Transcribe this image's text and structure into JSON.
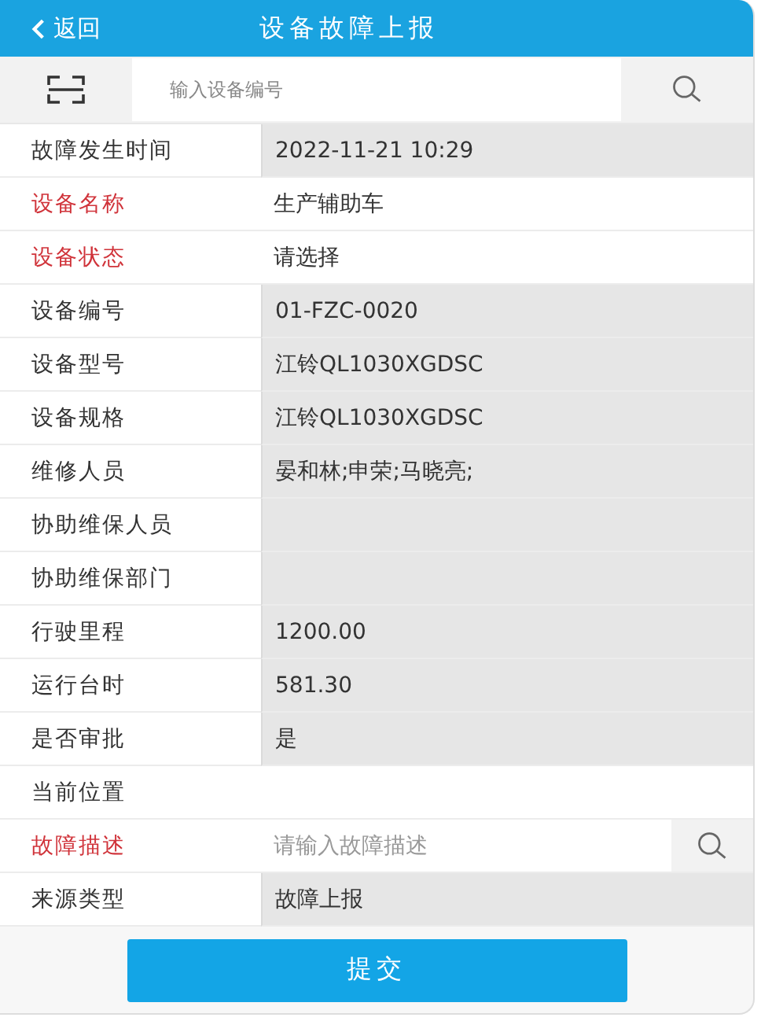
{
  "header": {
    "back": "返回",
    "title": "设备故障上报"
  },
  "search": {
    "placeholder": "输入设备编号"
  },
  "rows": [
    {
      "label": "故障发生时间",
      "required": false,
      "readonly": true,
      "value": "2022-11-21 10:29"
    },
    {
      "label": "设备名称",
      "required": true,
      "readonly": false,
      "value": "生产辅助车"
    },
    {
      "label": "设备状态",
      "required": true,
      "readonly": false,
      "value": "请选择"
    },
    {
      "label": "设备编号",
      "required": false,
      "readonly": true,
      "value": "01-FZC-0020"
    },
    {
      "label": "设备型号",
      "required": false,
      "readonly": true,
      "value": "江铃QL1030XGDSC"
    },
    {
      "label": "设备规格",
      "required": false,
      "readonly": true,
      "value": "江铃QL1030XGDSC"
    },
    {
      "label": "维修人员",
      "required": false,
      "readonly": true,
      "value": "晏和林;申荣;马晓亮;"
    },
    {
      "label": "协助维保人员",
      "required": false,
      "readonly": true
    },
    {
      "label": "协助维保部门",
      "required": false,
      "readonly": true
    },
    {
      "label": "行驶里程",
      "required": false,
      "readonly": true,
      "value": "1200.00"
    },
    {
      "label": "运行台时",
      "required": false,
      "readonly": true,
      "value": "581.30"
    },
    {
      "label": "是否审批",
      "required": false,
      "readonly": true,
      "value": "是"
    },
    {
      "label": "当前位置",
      "required": false,
      "readonly": false
    },
    {
      "label": "故障描述",
      "required": true,
      "readonly": false,
      "placeholder": "请输入故障描述",
      "kind": "search"
    },
    {
      "label": "来源类型",
      "required": false,
      "readonly": true,
      "value": "故障上报"
    }
  ],
  "submit": "提交"
}
